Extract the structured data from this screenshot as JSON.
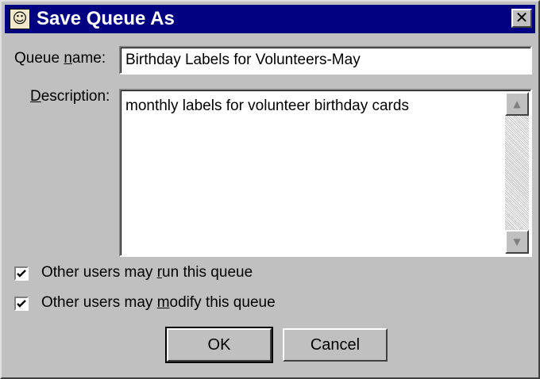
{
  "window": {
    "title": "Save Queue As",
    "close_glyph": "✕",
    "icon": "queue-app-icon"
  },
  "form": {
    "queue_name": {
      "label_before": "Queue ",
      "label_accel": "n",
      "label_after": "ame:",
      "value": "Birthday Labels for Volunteers-May"
    },
    "description": {
      "label_accel": "D",
      "label_after": "escription:",
      "value": "monthly labels for volunteer birthday cards",
      "scroll_up_glyph": "▲",
      "scroll_down_glyph": "▼"
    },
    "run_checkbox": {
      "checked": true,
      "label_before": "Other users may ",
      "label_accel": "r",
      "label_after": "un this queue"
    },
    "modify_checkbox": {
      "checked": true,
      "label_before": "Other users may ",
      "label_accel": "m",
      "label_after": "odify this queue"
    }
  },
  "buttons": {
    "ok_label": "OK",
    "cancel_label": "Cancel"
  },
  "colors": {
    "titlebar": "#000080",
    "face": "#c0c0c0"
  }
}
